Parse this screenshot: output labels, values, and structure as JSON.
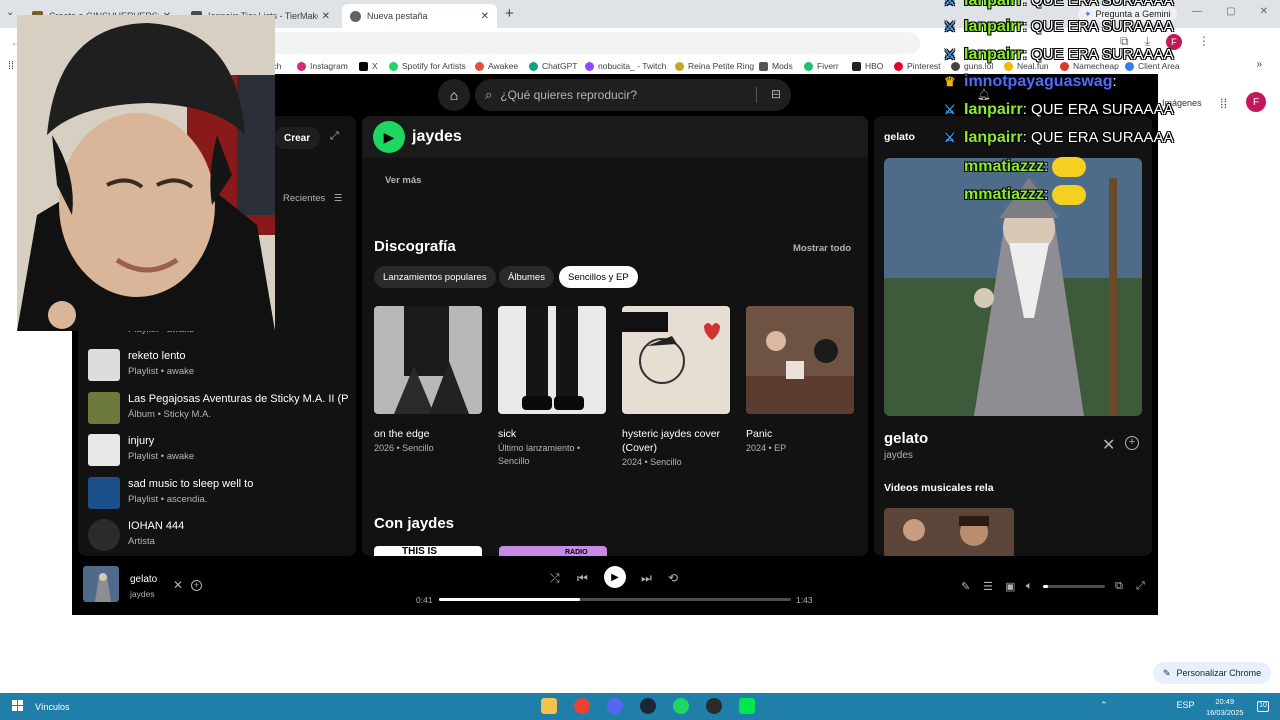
{
  "browser": {
    "tabs": [
      {
        "label": "Create a GINSHHERVERSO",
        "favicon_color": "#7b5c2e"
      },
      {
        "label": "Ianpairr Tier Lists - TierMaker",
        "favicon_color": "#4a4a4a"
      },
      {
        "label": "Nueva pestaña",
        "favicon_color": "#5f6368"
      }
    ],
    "gemini_label": "Pregunta a Gemini",
    "profile_letter": "F",
    "bookmarks": [
      {
        "label": "tch",
        "color": "#9146ff"
      },
      {
        "label": "Instagram",
        "color": "#d62976"
      },
      {
        "label": "X",
        "color": "#000000"
      },
      {
        "label": "Spotify for Artists",
        "color": "#1ed760"
      },
      {
        "label": "Awakee",
        "color": "#e74c3c"
      },
      {
        "label": "ChatGPT",
        "color": "#10a37f"
      },
      {
        "label": "nobucita_ - Twitch",
        "color": "#9146ff"
      },
      {
        "label": "Reina Petite Ring",
        "color": "#c9a227"
      },
      {
        "label": "Mods",
        "color": "#555555"
      },
      {
        "label": "Fiverr",
        "color": "#1dbf73"
      },
      {
        "label": "HBO",
        "color": "#222222"
      },
      {
        "label": "Pinterest",
        "color": "#e60023"
      },
      {
        "label": "guns.lol",
        "color": "#444444"
      },
      {
        "label": "Neal.fun",
        "color": "#f2b600"
      },
      {
        "label": "Namecheap",
        "color": "#de3723"
      },
      {
        "label": "Client Area",
        "color": "#2f80ed"
      }
    ]
  },
  "spotify": {
    "search_placeholder": "¿Qué quieres reproducir?",
    "images_link": "Imágenes",
    "avatar_letter": "F",
    "sidebar": {
      "create_label": "Crear",
      "recents_label": "Recientes",
      "partial_sub": "Playlist • awake",
      "items": [
        {
          "title": "reketo lento",
          "sub": "Playlist • awake",
          "color": "#dddddd"
        },
        {
          "title": "Las Pegajosas Aventuras de Sticky M.A. II (P...",
          "sub": "Álbum • Sticky M.A.",
          "color": "#6b7a3a"
        },
        {
          "title": "injury",
          "sub": "Playlist • awake",
          "color": "#e8e8e8"
        },
        {
          "title": "sad music to sleep well to",
          "sub": "Playlist • ascendia.",
          "color": "#1a4f8a"
        },
        {
          "title": "IOHAN 444",
          "sub": "Artista",
          "color": "#2b2b2b"
        }
      ]
    },
    "main": {
      "artist": "jaydes",
      "see_more": "Ver más",
      "discography_title": "Discografía",
      "show_all": "Mostrar todo",
      "chips": [
        "Lanzamientos populares",
        "Álbumes",
        "Sencillos y EP"
      ],
      "releases": [
        {
          "name": "on the edge",
          "meta": "2026 • Sencillo",
          "color": "#8a8a8a"
        },
        {
          "name": "sick",
          "meta": "Último lanzamiento • Sencillo",
          "color": "#2a2a2a"
        },
        {
          "name": "hysteric jaydes cover (Cover)",
          "meta": "2024 • Sencillo",
          "color": "#d8cfc4"
        },
        {
          "name": "Panic",
          "meta": "2024 • EP",
          "color": "#7a5a48"
        }
      ],
      "con_title": "Con jaydes",
      "card1_text": "THIS IS",
      "card2_text": "RADIO"
    },
    "now_playing": {
      "header": "gelato",
      "title": "gelato",
      "artist": "jaydes",
      "videos_label": "Videos musicales rela"
    },
    "player": {
      "title": "gelato",
      "artist": "jaydes",
      "elapsed": "0:41",
      "duration": "1:43",
      "progress": 0.4,
      "volume": 0.08
    }
  },
  "chat": [
    {
      "user": "Ianpairr",
      "msg": "QUE ERA SURAAAA"
    },
    {
      "user": "Ianpairr",
      "msg": "QUE ERA SURAAAA"
    },
    {
      "user": "Ianpairr",
      "msg": "QUE ERA SURAAAA"
    },
    {
      "user": "imnotpayaguaswag",
      "msg": ""
    },
    {
      "user": "Ianpairr",
      "msg": "QUE ERA SURAAAA"
    },
    {
      "user": "Ianpairr",
      "msg": "QUE ERA SURAAAA"
    },
    {
      "user": "mmatiazzz",
      "msg": ""
    },
    {
      "user": "mmatiazzz",
      "msg": ""
    }
  ],
  "customize_chrome": "Personalizar Chrome",
  "taskbar": {
    "left_label": "Vínculos",
    "lang": "ESP",
    "time": "20:49",
    "date": "16/03/2025",
    "notif_count": "10"
  }
}
